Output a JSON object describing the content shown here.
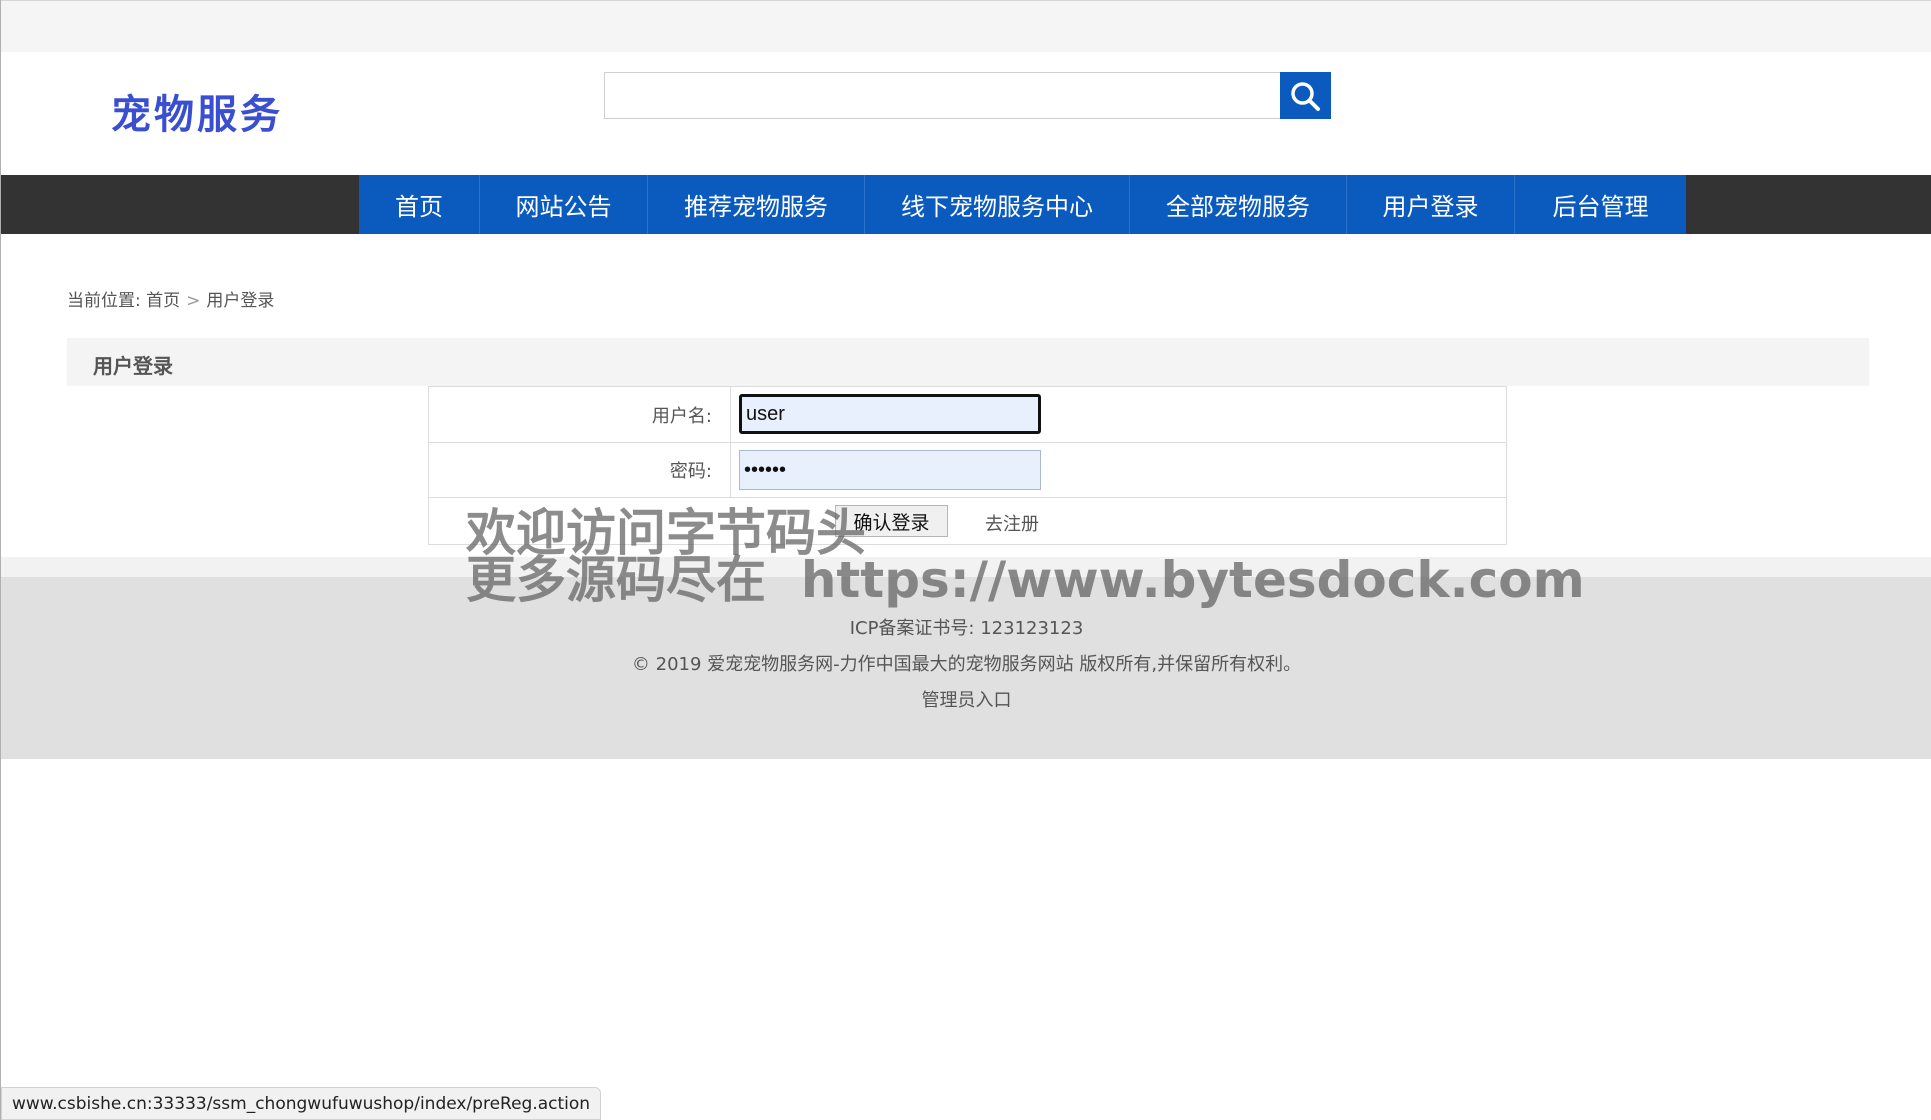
{
  "site": {
    "logo_text": "宠物服务",
    "brand_color": "#0b5bbf",
    "logo_color": "#3a4fd0"
  },
  "search": {
    "placeholder": "",
    "value": "",
    "icon": "search-icon"
  },
  "nav": {
    "items": [
      {
        "label": "首页"
      },
      {
        "label": "网站公告"
      },
      {
        "label": "推荐宠物服务"
      },
      {
        "label": "线下宠物服务中心"
      },
      {
        "label": "全部宠物服务"
      },
      {
        "label": "用户登录"
      },
      {
        "label": "后台管理"
      }
    ]
  },
  "breadcrumb": {
    "prefix": "当前位置:",
    "home": "首页",
    "separator": ">",
    "current": "用户登录"
  },
  "panel": {
    "title": "用户登录"
  },
  "form": {
    "username_label": "用户名:",
    "username_value": "user",
    "password_label": "密码:",
    "password_value": "••••••",
    "submit_label": "确认登录",
    "register_label": "去注册"
  },
  "footer": {
    "icp": "ICP备案证书号: 123123123",
    "copyright": "© 2019 爱宠宠物服务网-力作中国最大的宠物服务网站 版权所有,并保留所有权利。",
    "admin_link": "管理员入口"
  },
  "watermark": {
    "line1": "欢迎访问字节码头",
    "line2": "更多源码尽在  https://www.bytesdock.com"
  },
  "status_bar": {
    "url": "www.csbishe.cn:33333/ssm_chongwufuwushop/index/preReg.action"
  }
}
